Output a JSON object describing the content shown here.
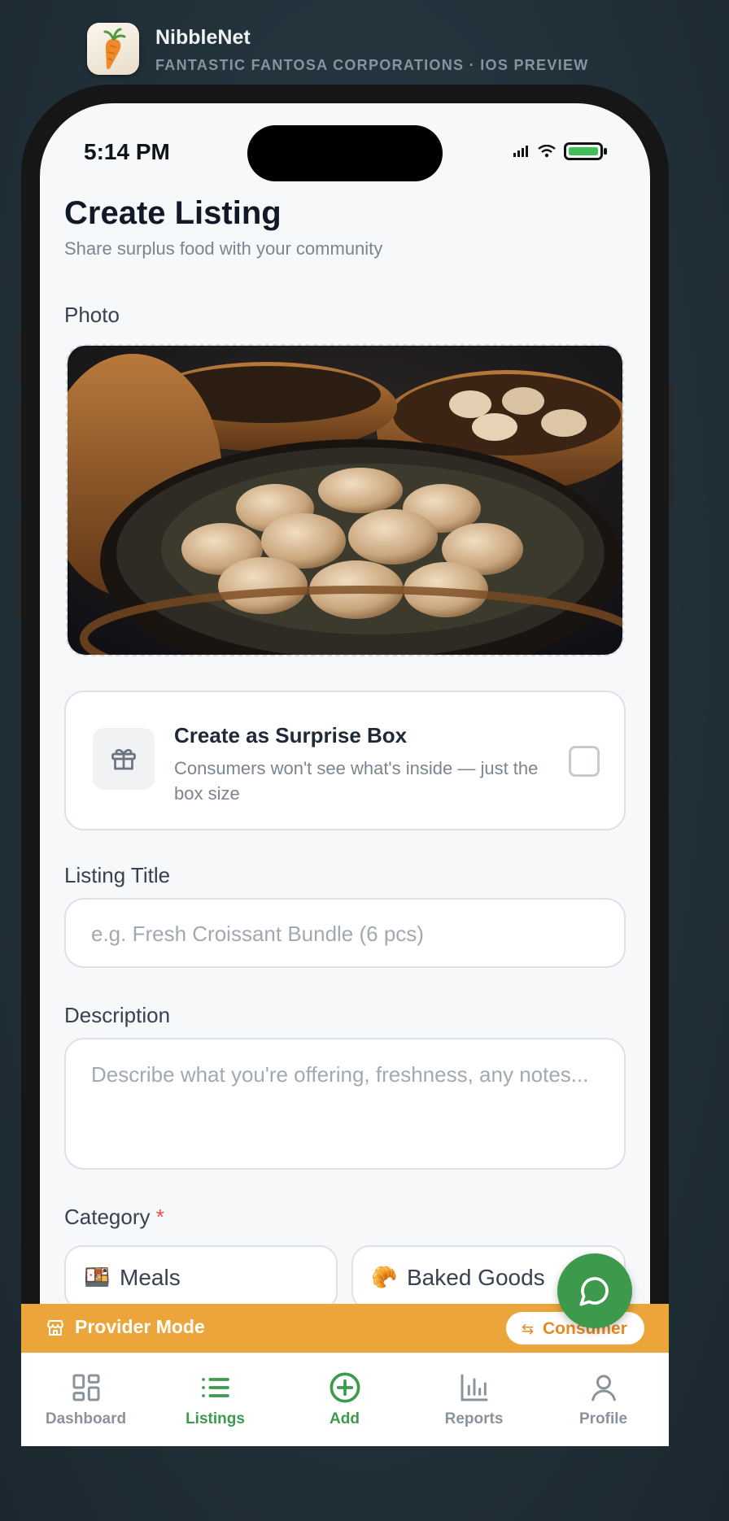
{
  "app": {
    "name": "NibbleNet",
    "subtitle": "FANTASTIC FANTOSA CORPORATIONS · IOS PREVIEW",
    "icon": "carrot-icon"
  },
  "status_bar": {
    "time": "5:14 PM",
    "icons": [
      "signal-icon",
      "wifi-icon",
      "battery-icon"
    ]
  },
  "page": {
    "title": "Create Listing",
    "subtitle": "Share surplus food with your community"
  },
  "photo": {
    "label": "Photo",
    "image": "steamed dumplings in bamboo steamers"
  },
  "surprise_box": {
    "title": "Create as Surprise Box",
    "description": "Consumers won't see what's inside — just the box size",
    "checked": false,
    "icon": "gift-icon"
  },
  "listing_title": {
    "label": "Listing Title",
    "placeholder": "e.g. Fresh Croissant Bundle (6 pcs)"
  },
  "description": {
    "label": "Description",
    "placeholder": "Describe what you're offering, freshness, any notes..."
  },
  "category": {
    "label": "Category",
    "required_mark": "*",
    "options": [
      {
        "emoji": "🍱",
        "label": "Meals"
      },
      {
        "emoji": "🥐",
        "label": "Baked Goods"
      }
    ]
  },
  "mode_bar": {
    "label": "Provider Mode",
    "switch_icon": "⇆",
    "switch_label": "Consumer",
    "icon": "store-icon",
    "color": "#eba53b"
  },
  "chat_fab": {
    "icon": "chat-bubble-icon",
    "color": "#3d9a4c"
  },
  "nav": {
    "items": [
      {
        "label": "Dashboard",
        "icon": "dashboard-icon"
      },
      {
        "label": "Listings",
        "icon": "list-icon"
      },
      {
        "label": "Add",
        "icon": "plus-circle-icon"
      },
      {
        "label": "Reports",
        "icon": "bar-chart-icon"
      },
      {
        "label": "Profile",
        "icon": "user-icon"
      }
    ],
    "active": "Listings",
    "active_color": "#3d9a4c"
  }
}
